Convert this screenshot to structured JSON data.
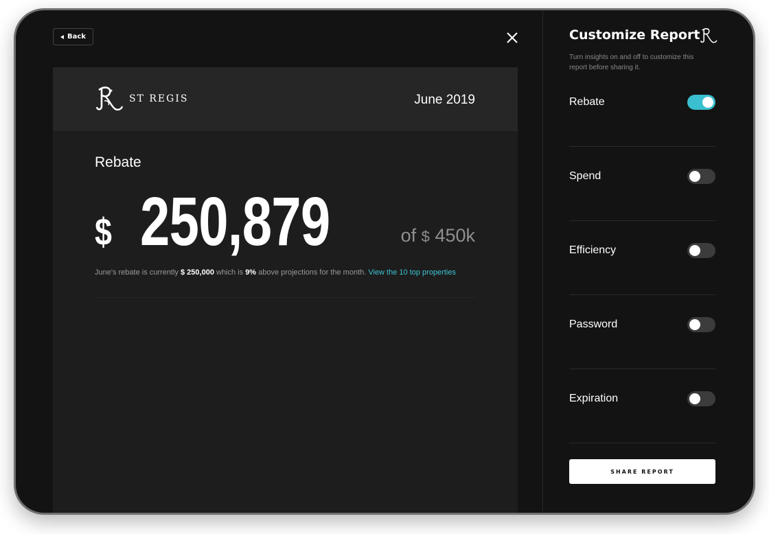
{
  "nav": {
    "back_label": "Back"
  },
  "report": {
    "brand": "ST REGIS",
    "date": "June 2019",
    "metric_label": "Rebate",
    "currency": "$",
    "value": "250,879",
    "of_prefix": "of",
    "of_currency": "$",
    "of_total": "450k",
    "summary": {
      "part1": "June's rebate is currently ",
      "amount": "$ 250,000",
      "part2": " which is ",
      "percent": "9%",
      "part3": " above projections for the month. ",
      "link": "View the 10 top properties"
    }
  },
  "panel": {
    "title": "Customize Report",
    "description": "Turn insights on and off to customize this report before sharing it.",
    "options": [
      {
        "label": "Rebate",
        "on": true
      },
      {
        "label": "Spend",
        "on": false
      },
      {
        "label": "Efficiency",
        "on": false
      },
      {
        "label": "Password",
        "on": false
      },
      {
        "label": "Expiration",
        "on": false
      }
    ],
    "share_label": "SHARE REPORT"
  },
  "colors": {
    "accent": "#39bfcf",
    "background": "#131313",
    "card": "#1d1d1d"
  }
}
